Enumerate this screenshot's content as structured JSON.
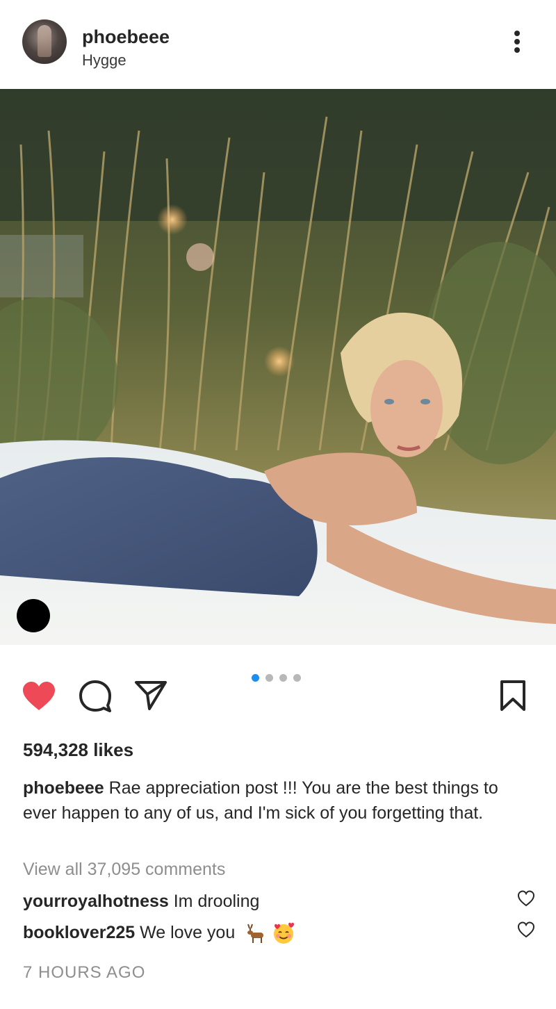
{
  "post": {
    "username": "phoebeee",
    "location": "Hygge",
    "image_alt": "Woman lying on a white blanket in tall grass",
    "likes": "594,328 likes",
    "caption_user": "phoebeee",
    "caption_text": " Rae appreciation post !!! You are the best things to ever happen to any of us, and I'm sick of you forgetting that.",
    "view_all": "View all 37,095 comments",
    "time": "7 HOURS AGO",
    "carousel": {
      "count": 4,
      "active": 0
    }
  },
  "comments": [
    {
      "user": "yourroyalhotness",
      "text": " Im drooling"
    },
    {
      "user": "booklover225",
      "text": " We love you ",
      "emojis": [
        "deer-emoji",
        "smiling-face-with-hearts-emoji"
      ]
    }
  ],
  "icons": {
    "more": "more-options-icon",
    "like": "heart-filled-icon",
    "comment": "comment-icon",
    "share": "send-icon",
    "save": "bookmark-icon"
  },
  "colors": {
    "like_red": "#ed4956",
    "active_dot": "#1d8eee",
    "muted_text": "#8e8e8e",
    "text": "#262626"
  }
}
